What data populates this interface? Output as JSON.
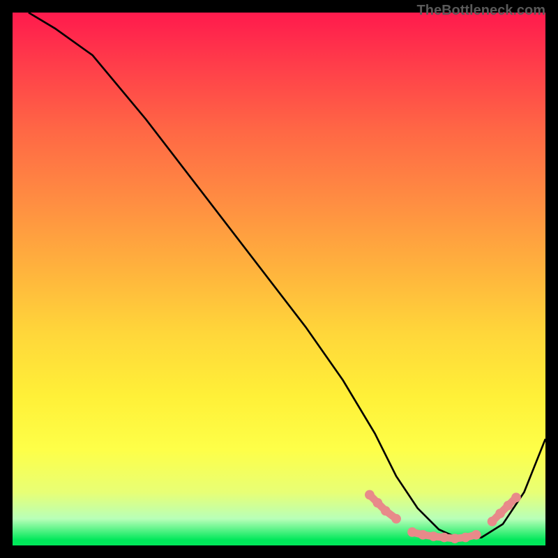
{
  "watermark": "TheBottleneck.com",
  "chart_data": {
    "type": "line",
    "title": "",
    "xlabel": "",
    "ylabel": "",
    "xlim": [
      0,
      100
    ],
    "ylim": [
      0,
      100
    ],
    "series": [
      {
        "name": "curve",
        "color": "#000000",
        "x": [
          3,
          8,
          15,
          25,
          35,
          45,
          55,
          62,
          68,
          72,
          76,
          80,
          84,
          88,
          92,
          96,
          100
        ],
        "y": [
          100,
          97,
          92,
          80,
          67,
          54,
          41,
          31,
          21,
          13,
          7,
          3,
          1.2,
          1.5,
          4,
          10,
          20
        ]
      }
    ],
    "highlight_segments": [
      {
        "name": "left-cluster",
        "color": "#e88a8a",
        "points": [
          {
            "x": 67,
            "y": 9.5
          },
          {
            "x": 68.5,
            "y": 8
          },
          {
            "x": 70,
            "y": 6.5
          },
          {
            "x": 72,
            "y": 5
          }
        ]
      },
      {
        "name": "bottom-cluster",
        "color": "#e88a8a",
        "points": [
          {
            "x": 75,
            "y": 2.5
          },
          {
            "x": 77,
            "y": 2
          },
          {
            "x": 79,
            "y": 1.7
          },
          {
            "x": 81,
            "y": 1.5
          },
          {
            "x": 83,
            "y": 1.3
          },
          {
            "x": 85,
            "y": 1.5
          },
          {
            "x": 87,
            "y": 2
          }
        ]
      },
      {
        "name": "right-cluster",
        "color": "#e88a8a",
        "points": [
          {
            "x": 90,
            "y": 4.5
          },
          {
            "x": 91.5,
            "y": 6
          },
          {
            "x": 93,
            "y": 7.5
          },
          {
            "x": 94.5,
            "y": 9
          }
        ]
      }
    ]
  }
}
